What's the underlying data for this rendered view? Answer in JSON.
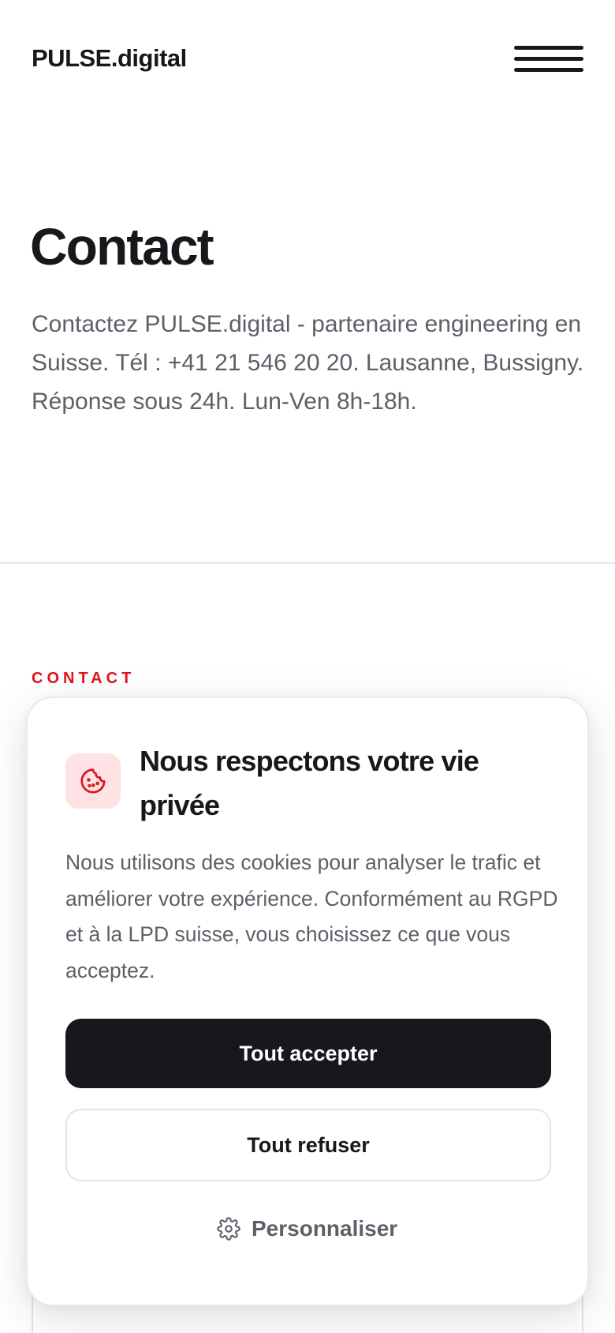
{
  "header": {
    "logo": "PULSE.digital",
    "menu_icon": "hamburger-menu-icon"
  },
  "hero": {
    "title": "Contact",
    "description": "Contactez PULSE.digital - partenaire engineering en Suisse. Tél : +41 21 546 20 20. Lausanne, Bussigny. Réponse sous 24h. Lun-Ven 8h-18h."
  },
  "section": {
    "eyebrow": "CONTACT"
  },
  "cookie_banner": {
    "icon": "cookie-icon",
    "title": "Nous respectons votre vie privée",
    "text": "Nous utilisons des cookies pour analyser le trafic et améliorer votre expérience. Conformément au RGPD et à la LPD suisse, vous choisissez ce que vous acceptez.",
    "accept_label": "Tout accepter",
    "refuse_label": "Tout refuser",
    "customize_label": "Personnaliser",
    "customize_icon": "gear-icon"
  },
  "colors": {
    "accent": "#e0141c",
    "text_dark": "#16181c",
    "text_muted": "#5d6068",
    "icon_bg": "#fde3e4"
  }
}
